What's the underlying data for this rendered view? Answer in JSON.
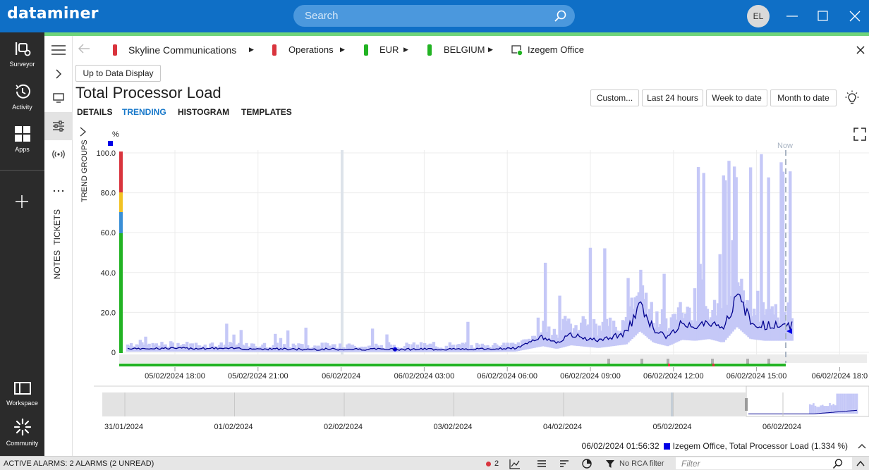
{
  "app": {
    "logo": "dataminer",
    "search_placeholder": "Search",
    "user_initials": "EL"
  },
  "nav": {
    "items": [
      {
        "label": "Surveyor",
        "icon": "surveyor-icon"
      },
      {
        "label": "Activity",
        "icon": "activity-icon"
      },
      {
        "label": "Apps",
        "icon": "apps-icon"
      },
      {
        "label": "Workspace",
        "icon": "workspace-icon"
      },
      {
        "label": "Community",
        "icon": "community-icon"
      }
    ]
  },
  "side_panel": {
    "tickets": "TICKETS",
    "notes": "NOTES",
    "trend_groups": "TREND GROUPS"
  },
  "breadcrumb": [
    {
      "label": "Skyline Communications",
      "color": "#d9343d"
    },
    {
      "label": "Operations",
      "color": "#d9343d"
    },
    {
      "label": "EUR",
      "color": "#22b323"
    },
    {
      "label": "BELGIUM",
      "color": "#22b323"
    },
    {
      "label": "Izegem Office",
      "color": "#22b323"
    }
  ],
  "content": {
    "back_button": "Up to Data Display",
    "title": "Total Processor Load",
    "range_buttons": [
      "Custom...",
      "Last 24 hours",
      "Week to date",
      "Month to date"
    ],
    "tabs": [
      "DETAILS",
      "TRENDING",
      "HISTOGRAM",
      "TEMPLATES"
    ],
    "active_tab": "TRENDING"
  },
  "chart_data": {
    "type": "line",
    "title": "Total Processor Load",
    "ylabel": "%",
    "ylim": [
      0,
      100
    ],
    "yticks": [
      "100.0",
      "80.0",
      "60.0",
      "40.0",
      "20.0",
      "0"
    ],
    "xticks": [
      "05/02/2024 18:00",
      "05/02/2024 21:00",
      "06/02/2024",
      "06/02/2024 03:00",
      "06/02/2024 06:00",
      "06/02/2024 09:00",
      "06/02/2024 12:00",
      "06/02/2024 15:00",
      "06/02/2024 18:0"
    ],
    "now_label": "Now",
    "series": [
      {
        "name": "Izegem Office, Total Processor Load",
        "color": "#0000e6",
        "x_hours": [
          0,
          3,
          6,
          9,
          12,
          14,
          15,
          15.5,
          16,
          17,
          18,
          18.5,
          19,
          19.5,
          20,
          20.5,
          21,
          21.5,
          22,
          22.5,
          23
        ],
        "values": [
          2,
          2,
          1.5,
          1.5,
          1.5,
          2,
          8,
          5,
          9,
          6,
          10,
          25,
          12,
          8,
          15,
          14,
          16,
          12,
          30,
          16,
          14
        ]
      }
    ],
    "navigator_xticks": [
      "31/01/2024",
      "01/02/2024",
      "02/02/2024",
      "03/02/2024",
      "04/02/2024",
      "05/02/2024",
      "06/02/2024"
    ]
  },
  "legend": {
    "timestamp": "06/02/2024 01:56:32",
    "series_label": "Izegem Office, Total Processor Load (1.334 %)"
  },
  "statusbar": {
    "alarms": "ACTIVE ALARMS: 2 ALARMS (2 UNREAD)",
    "alarm_count": "2",
    "rca_filter": "No RCA filter",
    "filter_placeholder": "Filter"
  }
}
